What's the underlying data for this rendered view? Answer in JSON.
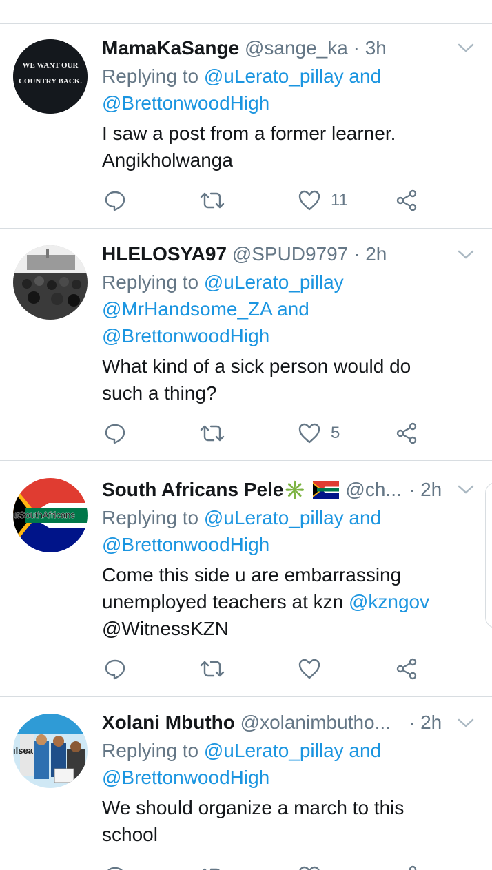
{
  "tweets": [
    {
      "name": "MamaKaSange",
      "handle": "@sange_ka",
      "time": "3h",
      "reply_prefix": "Replying to",
      "reply_lines": [
        "@uLerato_pillay and",
        "@BrettonwoodHigh"
      ],
      "body_lines": [
        "I saw a post from a former learner.",
        "Angikholwanga"
      ],
      "like_count": "11",
      "avatar_text": [
        "WE WANT OUR",
        "COUNTRY BACK."
      ]
    },
    {
      "name": "HLELOSYA97",
      "handle": "@SPUD9797",
      "time": "2h",
      "reply_prefix": "Replying to",
      "reply_lines": [
        "@uLerato_pillay",
        "@MrHandsome_ZA and",
        "@BrettonwoodHigh"
      ],
      "body_lines": [
        "What kind of a sick person would do",
        "such a thing?"
      ],
      "like_count": "5"
    },
    {
      "name": "South Africans Pele",
      "name_emoji": "✳️",
      "handle": "@ch...",
      "time": "2h",
      "reply_prefix": "Replying to",
      "reply_lines": [
        "@uLerato_pillay and",
        "@BrettonwoodHigh"
      ],
      "body_lines": [
        "Come this side u are embarrassing",
        "unemployed teachers at kzn ",
        "@WitnessKZN"
      ],
      "body_mention": "@kzngov",
      "like_count": "",
      "avatar_text": "utSouthAfricans"
    },
    {
      "name": "Xolani Mbutho",
      "handle": "@xolanimbutho...",
      "time": "2h",
      "reply_prefix": "Replying to",
      "reply_lines": [
        "@uLerato_pillay and",
        "@BrettonwoodHigh"
      ],
      "body_lines": [
        "We should organize a march to this",
        "school"
      ],
      "like_count": "",
      "avatar_text": "ılsea"
    }
  ],
  "separator": "·",
  "colors": {
    "link": "#1b95e0",
    "muted": "#657786",
    "text": "#14171a",
    "divider": "#d8dde1"
  },
  "icons": {
    "reply": "reply-icon",
    "retweet": "retweet-icon",
    "like": "like-icon",
    "share": "share-icon",
    "menu": "chevron-down-icon"
  }
}
